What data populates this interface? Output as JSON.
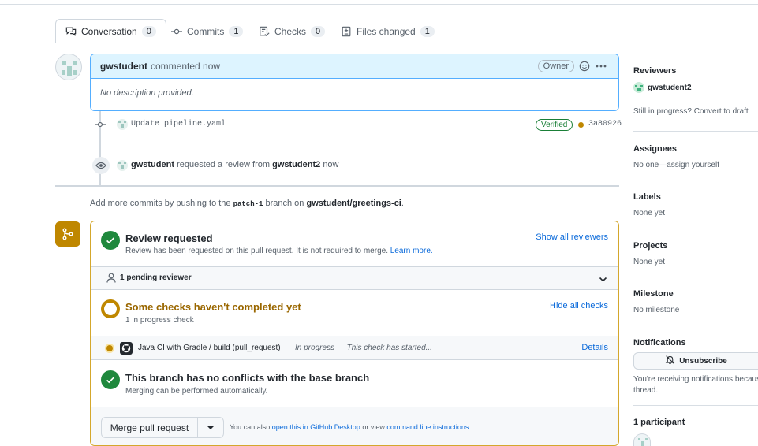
{
  "tabs": [
    {
      "label": "Conversation",
      "count": "0"
    },
    {
      "label": "Commits",
      "count": "1"
    },
    {
      "label": "Checks",
      "count": "0"
    },
    {
      "label": "Files changed",
      "count": "1"
    }
  ],
  "comment": {
    "author": "gwstudent",
    "action": "commented now",
    "badge": "Owner",
    "body": "No description provided."
  },
  "commit": {
    "message": "Update pipeline.yaml",
    "verified": "Verified",
    "sha": "3a80926"
  },
  "review_event": {
    "author": "gwstudent",
    "text": "requested a review from",
    "reviewer": "gwstudent2",
    "time": "now"
  },
  "push_note": {
    "prefix": "Add more commits by pushing to the",
    "branch": "patch-1",
    "middle": "branch on",
    "repo": "gwstudent/greetings-ci",
    "suffix": "."
  },
  "mergebox": {
    "review": {
      "title": "Review requested",
      "desc": "Review has been requested on this pull request. It is not required to merge.",
      "learn_more": "Learn more.",
      "action": "Show all reviewers"
    },
    "pending": {
      "label": "1 pending reviewer"
    },
    "checks": {
      "title": "Some checks haven't completed yet",
      "desc": "1 in progress check",
      "action": "Hide all checks"
    },
    "check_item": {
      "name": "Java CI with Gradle / build (pull_request)",
      "status": "In progress — This check has started...",
      "details": "Details"
    },
    "conflicts": {
      "title": "This branch has no conflicts with the base branch",
      "desc": "Merging can be performed automatically."
    },
    "merge": {
      "button": "Merge pull request",
      "note_prefix": "You can also",
      "desktop_link": "open this in GitHub Desktop",
      "note_middle": "or view",
      "cli_link": "command line instructions",
      "note_suffix": "."
    }
  },
  "sidebar": {
    "reviewers": {
      "heading": "Reviewers",
      "name": "gwstudent2",
      "note": "Still in progress? Convert to draft"
    },
    "assignees": {
      "heading": "Assignees",
      "value": "No one—assign yourself"
    },
    "labels": {
      "heading": "Labels",
      "value": "None yet"
    },
    "projects": {
      "heading": "Projects",
      "value": "None yet"
    },
    "milestone": {
      "heading": "Milestone",
      "value": "No milestone"
    },
    "notifications": {
      "heading": "Notifications",
      "button": "Unsubscribe",
      "note": "You're receiving notifications because",
      "note2": "thread."
    },
    "participants": {
      "heading": "1 participant"
    }
  },
  "colors": {
    "accent": "#0969da",
    "success": "#1f883d",
    "warning": "#bf8700",
    "comment_bg": "#ddf4ff"
  }
}
